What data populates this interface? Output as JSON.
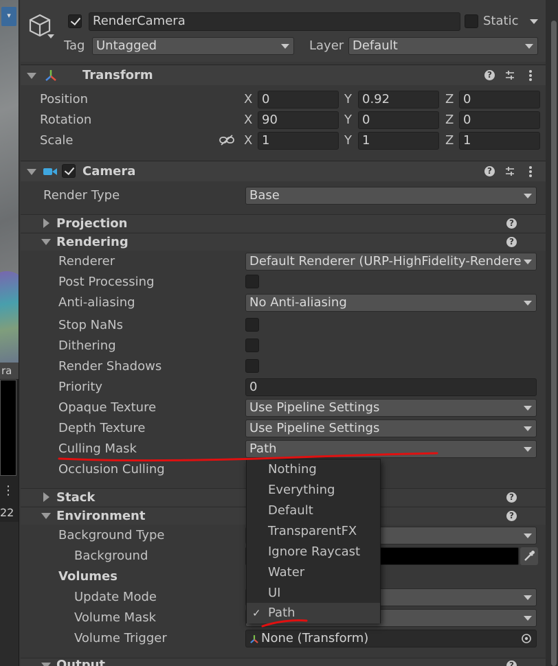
{
  "left_strip": {
    "label": "ra",
    "number": "22"
  },
  "object": {
    "name": "RenderCamera",
    "active": true,
    "static_label": "Static",
    "tag_label": "Tag",
    "tag_value": "Untagged",
    "layer_label": "Layer",
    "layer_value": "Default"
  },
  "transform": {
    "title": "Transform",
    "rows": [
      {
        "label": "Position",
        "x": "0",
        "y": "0.92",
        "z": "0"
      },
      {
        "label": "Rotation",
        "x": "90",
        "y": "0",
        "z": "0"
      },
      {
        "label": "Scale",
        "x": "1",
        "y": "1",
        "z": "1"
      }
    ],
    "axes": {
      "x": "X",
      "y": "Y",
      "z": "Z"
    }
  },
  "camera": {
    "title": "Camera",
    "enabled": true,
    "render_type_label": "Render Type",
    "render_type_value": "Base",
    "projection_label": "Projection",
    "rendering_label": "Rendering",
    "renderer_label": "Renderer",
    "renderer_value": "Default Renderer (URP-HighFidelity-Rendere",
    "post_processing_label": "Post Processing",
    "antialiasing_label": "Anti-aliasing",
    "antialiasing_value": "No Anti-aliasing",
    "stop_nans_label": "Stop NaNs",
    "dithering_label": "Dithering",
    "render_shadows_label": "Render Shadows",
    "priority_label": "Priority",
    "priority_value": "0",
    "opaque_texture_label": "Opaque Texture",
    "opaque_texture_value": "Use Pipeline Settings",
    "depth_texture_label": "Depth Texture",
    "depth_texture_value": "Use Pipeline Settings",
    "culling_mask_label": "Culling Mask",
    "culling_mask_value": "Path",
    "occlusion_culling_label": "Occlusion Culling",
    "stack_label": "Stack",
    "environment_label": "Environment",
    "background_type_label": "Background Type",
    "background_label": "Background",
    "volumes_label": "Volumes",
    "update_mode_label": "Update Mode",
    "volume_mask_label": "Volume Mask",
    "volume_trigger_label": "Volume Trigger",
    "volume_trigger_value": "None (Transform)",
    "output_label": "Output"
  },
  "culling_mask_options": [
    {
      "label": "Nothing",
      "selected": false
    },
    {
      "label": "Everything",
      "selected": false
    },
    {
      "label": "Default",
      "selected": false
    },
    {
      "label": "TransparentFX",
      "selected": false
    },
    {
      "label": "Ignore Raycast",
      "selected": false
    },
    {
      "label": "Water",
      "selected": false
    },
    {
      "label": "UI",
      "selected": false
    },
    {
      "label": "Path",
      "selected": true
    }
  ],
  "check_glyph": "✓",
  "help_glyph": "?",
  "colors": {
    "annotation": "#e01010",
    "panel": "#383838",
    "field": "#2a2a2a",
    "dropdown": "#515151"
  }
}
